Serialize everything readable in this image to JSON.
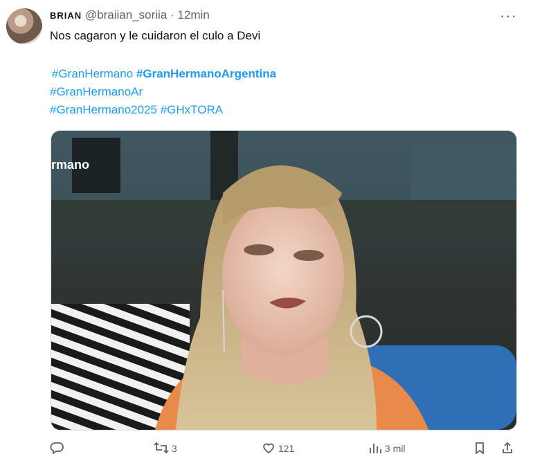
{
  "tweet": {
    "display_name": "BRIAN",
    "handle": "@braiian_soriia",
    "separator": "·",
    "time": "12min",
    "more_label": "···",
    "text": "Nos cagaron y le cuidaron el culo a Devi",
    "hashtags": [
      {
        "text": "#GranHermano",
        "bold": false
      },
      {
        "text": "#GranHermanoArgentina",
        "bold": true
      },
      {
        "text": "#GranHermanoAr",
        "bold": false
      },
      {
        "text": "#GranHermano2025",
        "bold": false
      },
      {
        "text": "#GHxTORA",
        "bold": false
      }
    ],
    "media": {
      "watermark": "rmano"
    },
    "actions": {
      "reply_icon": "reply-icon",
      "retweets": "3",
      "likes": "121",
      "views": "3 mil"
    }
  }
}
